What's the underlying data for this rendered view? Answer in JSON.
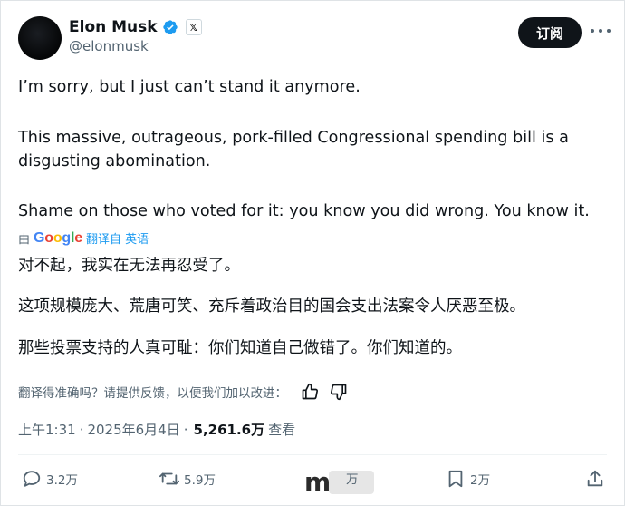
{
  "author": {
    "name": "Elon Musk",
    "handle": "@elonmusk",
    "x_badge": "𝕏"
  },
  "header": {
    "subscribe_label": "订阅",
    "more_icon": "more-horizontal-icon"
  },
  "tweet": {
    "original_lines": [
      "I’m sorry, but I just can’t stand it anymore.",
      "This massive, outrageous, pork-filled Congressional spending bill is a",
      "disgusting abomination.",
      "Shame on those who voted for it: you know you did wrong. You know it."
    ],
    "translation_prefix": "由",
    "translation_provider": "Google",
    "translation_link": "翻译自 英语",
    "translated_lines": [
      "对不起，我实在无法再忍受了。",
      "这项规模庞大、荒唐可笑、充斥着政治目的国会支出法案令人厌恶至极。",
      "那些投票支持的人真可耻：你们知道自己做错了。你们知道的。"
    ],
    "feedback_prompt": "翻译得准确吗？请提供反馈，以便我们加以改进："
  },
  "meta": {
    "time": "上午1:31",
    "date": "2025年6月4日",
    "views": "5,261.6万",
    "views_label": "查看"
  },
  "actions": {
    "replies": "3.2万",
    "reposts": "5.9万",
    "likes_partial": "万",
    "bookmarks": "2万"
  },
  "colors": {
    "text": "#0f1419",
    "secondary": "#536471",
    "verified": "#1d9bf0",
    "button_bg": "#0f1419"
  }
}
